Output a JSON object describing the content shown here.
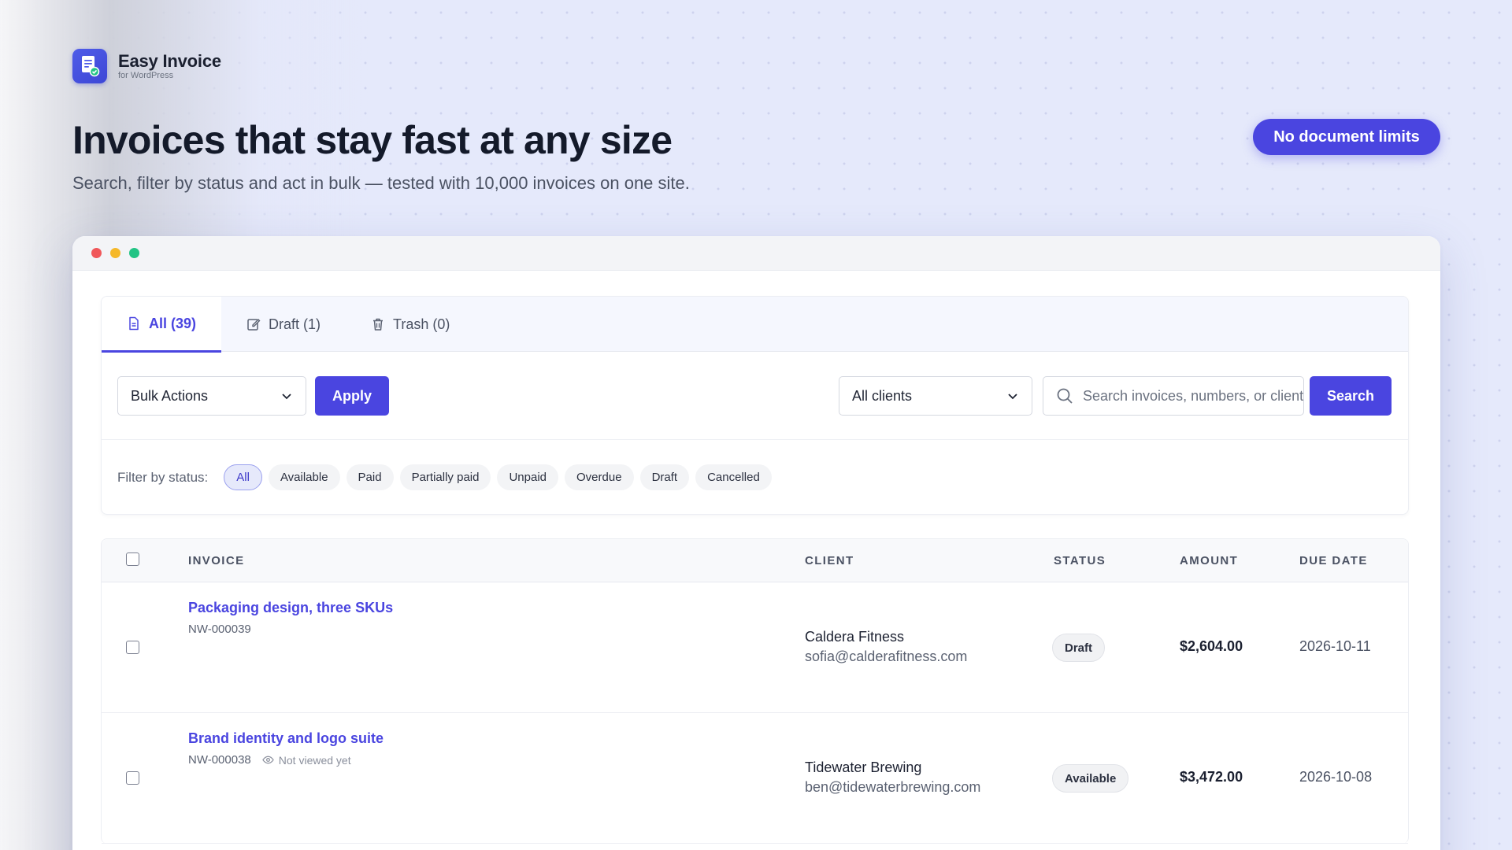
{
  "brand": {
    "name": "Easy Invoice",
    "subtitle": "for WordPress"
  },
  "hero": {
    "title": "Invoices that stay fast at any size",
    "subtitle": "Search, filter by status and act in bulk — tested with 10,000 invoices on one site.",
    "badge": "No document limits"
  },
  "tabs": [
    {
      "label": "All (39)",
      "icon": "document-icon",
      "active": true
    },
    {
      "label": "Draft (1)",
      "icon": "edit-icon",
      "active": false
    },
    {
      "label": "Trash (0)",
      "icon": "trash-icon",
      "active": false
    }
  ],
  "toolbar": {
    "bulk_select": "Bulk Actions",
    "apply_label": "Apply",
    "client_select": "All clients",
    "search_placeholder": "Search invoices, numbers, or clients",
    "search_label": "Search"
  },
  "filters": {
    "label": "Filter by status:",
    "chips": [
      "All",
      "Available",
      "Paid",
      "Partially paid",
      "Unpaid",
      "Overdue",
      "Draft",
      "Cancelled"
    ],
    "active": "All"
  },
  "table": {
    "columns": {
      "invoice": "INVOICE",
      "client": "CLIENT",
      "status": "STATUS",
      "amount": "AMOUNT",
      "due_date": "DUE DATE"
    },
    "rows": [
      {
        "title": "Packaging design, three SKUs",
        "number": "NW-000039",
        "view_note": "",
        "client": "Caldera Fitness",
        "email": "sofia@calderafitness.com",
        "status": "Draft",
        "amount": "$2,604.00",
        "due": "2026-10-11"
      },
      {
        "title": "Brand identity and logo suite",
        "number": "NW-000038",
        "view_note": "Not viewed yet",
        "client": "Tidewater Brewing",
        "email": "ben@tidewaterbrewing.com",
        "status": "Available",
        "amount": "$3,472.00",
        "due": "2026-10-08"
      }
    ]
  },
  "colors": {
    "accent": "#4a45e0",
    "background": "#e5e9fb"
  }
}
